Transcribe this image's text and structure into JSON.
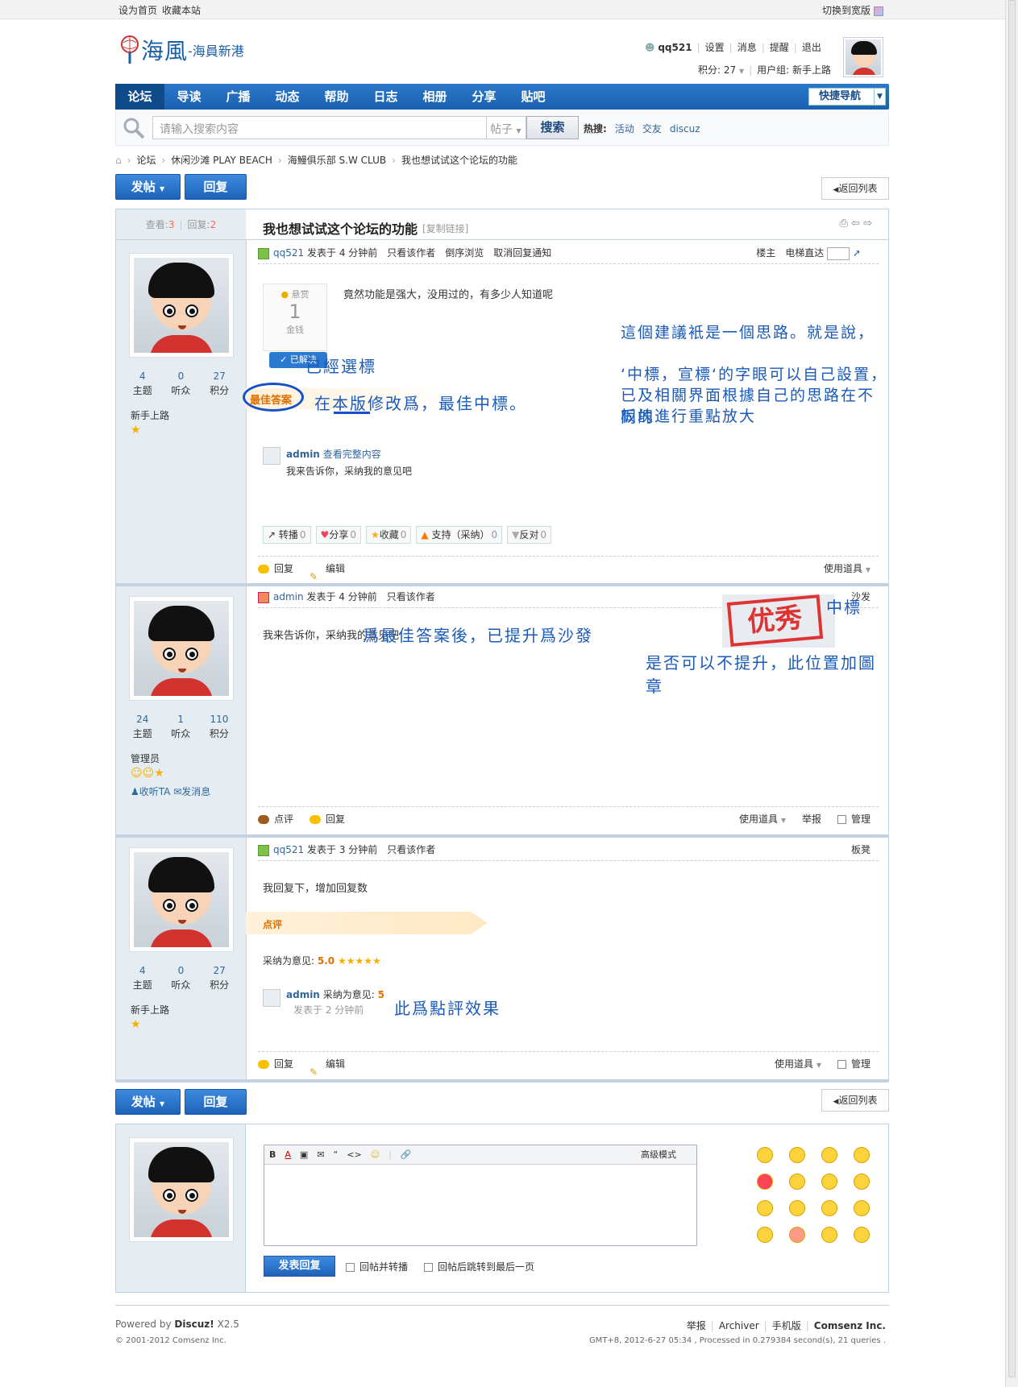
{
  "top": {
    "set_home": "设为首页",
    "favorite": "收藏本站",
    "switch_wide": "切换到宽版"
  },
  "logo": {
    "title": "海風",
    "sub": "-海員新港"
  },
  "user": {
    "name": "qq521",
    "settings": "设置",
    "messages": "消息",
    "remind": "提醒",
    "logout": "退出",
    "points": "积分: 27",
    "group": "用户组: 新手上路"
  },
  "nav": {
    "items": [
      "论坛",
      "导读",
      "广播",
      "动态",
      "帮助",
      "日志",
      "相册",
      "分享",
      "贴吧"
    ],
    "quick": "快捷导航"
  },
  "search": {
    "placeholder": "请输入搜索内容",
    "type": "帖子",
    "button": "搜索",
    "hot_label": "热搜:",
    "hot": [
      "活动",
      "交友",
      "discuz"
    ]
  },
  "crumbs": [
    "论坛",
    "休闲沙滩 PLAY BEACH",
    "海鰻俱乐部 S.W CLUB",
    "我也想试试这个论坛的功能"
  ],
  "buttons": {
    "post": "发帖",
    "reply": "回复",
    "back": "返回列表"
  },
  "thread": {
    "views_label": "查看:",
    "views": "3",
    "replies_label": "回复:",
    "replies": "2",
    "title": "我也想试试这个论坛的功能",
    "copy_link": "[复制链接]"
  },
  "labels": {
    "topics": "主题",
    "listen": "听众",
    "points": "积分",
    "posted": "发表于",
    "only_author": "只看该作者",
    "reverse": "倒序浏览",
    "cancel_notify": "取消回复通知",
    "reply": "回复",
    "edit": "编辑",
    "tools": "使用道具",
    "report": "举报",
    "manage": "管理",
    "comment": "点评",
    "follow": "收听TA",
    "sendmsg": "发消息",
    "elevator": "电梯直达"
  },
  "post1": {
    "author": "qq521",
    "time": "4 分钟前",
    "floor": "楼主",
    "content": "竟然功能是强大，没用过的，有多少人知道呢",
    "reward_label": "悬赏",
    "reward_num": "1",
    "reward_unit": "金钱",
    "solved": "已解决",
    "best": "最佳答案",
    "best_author": "admin",
    "best_view": "查看完整内容",
    "best_text": "我来告诉你，采纳我的意见吧",
    "stats": [
      "4",
      "0",
      "27"
    ],
    "group": "新手上路",
    "actions": [
      {
        "label": "转播",
        "count": "0"
      },
      {
        "label": "分享",
        "count": "0"
      },
      {
        "label": "收藏",
        "count": "0"
      },
      {
        "label": "支持（采纳）",
        "count": "0"
      },
      {
        "label": "反对",
        "count": "0"
      }
    ]
  },
  "post2": {
    "author": "admin",
    "time": "4 分钟前",
    "floor": "沙发",
    "content": "我来告诉你，采纳我的意见吧",
    "stats": [
      "24",
      "1",
      "110"
    ],
    "group": "管理员",
    "stamp": "优秀"
  },
  "post3": {
    "author": "qq521",
    "time": "3 分钟前",
    "floor": "板凳",
    "content": "我回复下，增加回复数",
    "comment_title": "点评",
    "rating_label": "采纳为意见:",
    "rating": "5.0",
    "c_author": "admin",
    "c_label": "采纳为意见:",
    "c_score": "5",
    "c_posted": "发表于",
    "c_time": "2 分钟前",
    "stats": [
      "4",
      "0",
      "27"
    ],
    "group": "新手上路"
  },
  "annotations": {
    "a1": "已經選標",
    "a2": "在本版修改爲，最佳中標。",
    "a3": "這個建議衹是一個思路。就是說，",
    "a4": "‘中標，宣標‘的字眼可以自己設置，",
    "a5": "已及相關界面根據自己的思路在不同的",
    "a6": "板塊進行重點放大",
    "a7": "爲最佳答案後，已提升爲沙發",
    "a8": "中標",
    "a9": "是否可以不提升，此位置加圖章",
    "a10": "此爲點評效果"
  },
  "editor": {
    "advanced": "高级模式",
    "submit": "发表回复",
    "opt1": "回帖并转播",
    "opt2": "回帖后跳转到最后一页"
  },
  "footer": {
    "powered": "Powered by",
    "brand": "Discuz!",
    "ver": "X2.5",
    "copy": "© 2001-2012 Comsenz Inc.",
    "links": [
      "举报",
      "Archiver",
      "手机版",
      "Comsenz Inc."
    ],
    "gmt": "GMT+8, 2012-6-27 05:34 , Processed in 0.279384 second(s), 21 queries ."
  },
  "colors": {
    "nav_blue": "#1b61b0",
    "sidebar": "#e5edf2",
    "annotation": "#1a5ab8",
    "stamp_red": "#d33"
  }
}
